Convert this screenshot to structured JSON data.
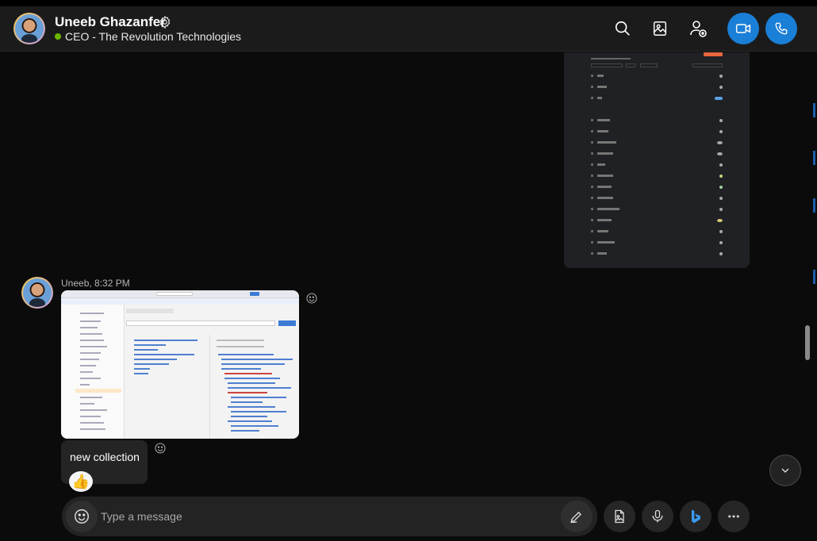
{
  "header": {
    "name": "Uneeb Ghazanfer",
    "status": "CEO - The Revolution Technologies",
    "status_color": "#6bb700",
    "icons": [
      "gear-icon",
      "search-icon",
      "gallery-icon",
      "add-person-icon",
      "video-call-icon",
      "phone-call-icon"
    ],
    "accent_color": "#1a7fd6"
  },
  "messages": {
    "sender_meta": "Uneeb, 8:32 PM",
    "text_message": "new collection",
    "reaction": "👍"
  },
  "composer": {
    "placeholder": "Type a message"
  }
}
